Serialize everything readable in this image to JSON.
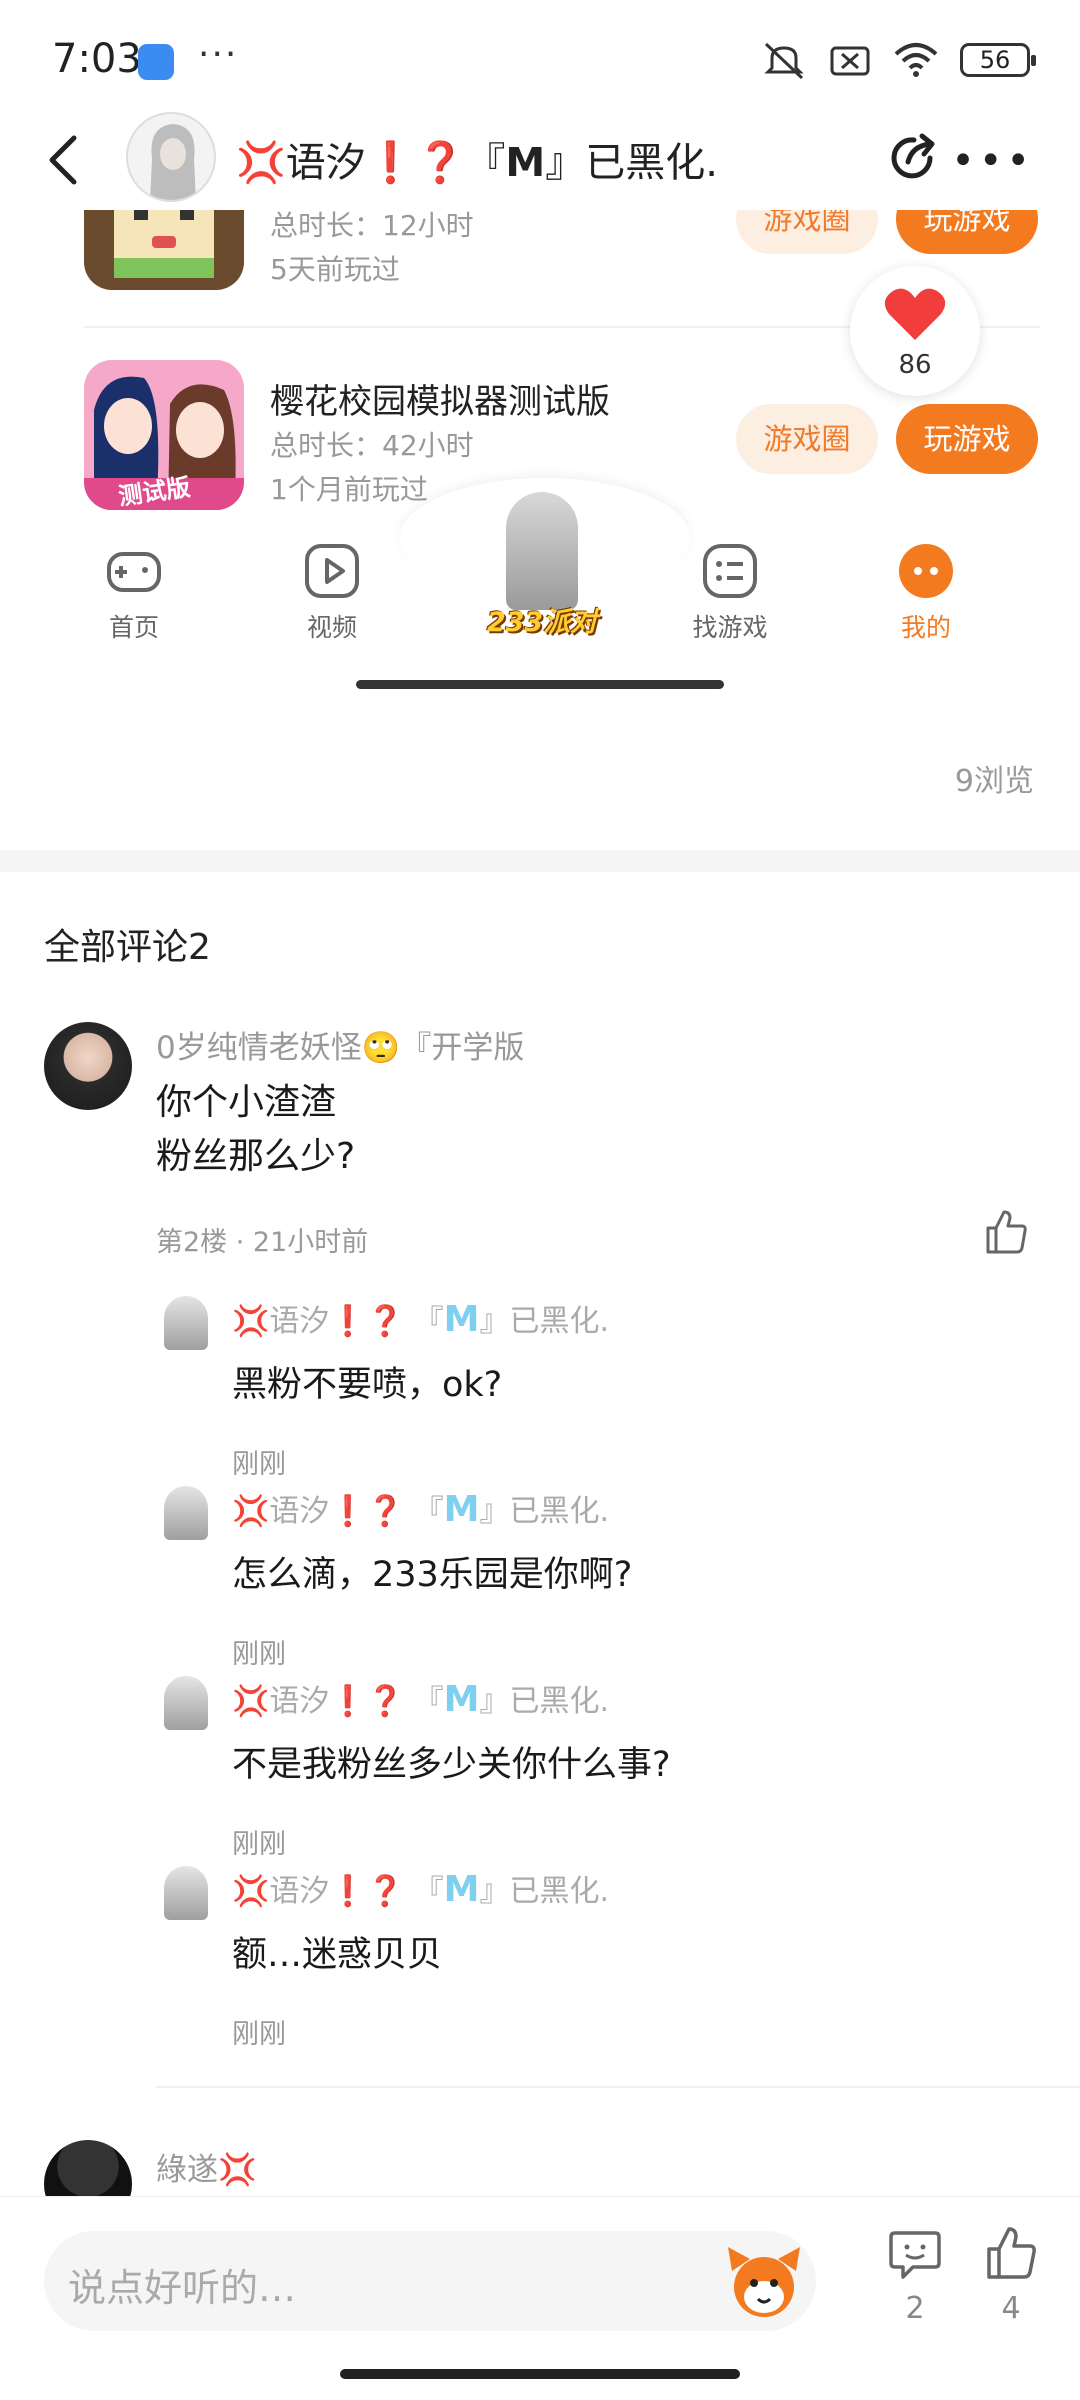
{
  "status_bar": {
    "time": "7:03",
    "more": "···",
    "battery": "56"
  },
  "header": {
    "title": "💢语汐❗❓『𝗠』已黑化."
  },
  "embedded": {
    "games": [
      {
        "name": "",
        "sub1": "总时长：12小时",
        "sub2": "5天前玩过",
        "circle_label": "游戏圈",
        "play_label": "玩游戏"
      },
      {
        "name": "樱花校园模拟器测试版",
        "sub1": "总时长：42小时",
        "sub2": "1个月前玩过",
        "circle_label": "游戏圈",
        "play_label": "玩游戏",
        "icon_badge": "测试版"
      }
    ],
    "like_count": "86",
    "tabs": [
      {
        "label": "首页"
      },
      {
        "label": "视频"
      },
      {
        "label": "233派对"
      },
      {
        "label": "找游戏"
      },
      {
        "label": "我的"
      }
    ]
  },
  "views": "9浏览",
  "comments": {
    "title": "全部评论2",
    "main": {
      "author": "0岁纯情老妖怪🙄『开学版",
      "text": "你个小渣渣\n粉丝那么少?",
      "meta": "第2楼 · 21小时前"
    },
    "reply_author": {
      "prefix": "💢语汐",
      "marks": "❗❓",
      "bracket_open": "『",
      "m": "M",
      "bracket_close": "』已黑化."
    },
    "replies": [
      {
        "text": "黑粉不要喷，ok?",
        "time": "刚刚"
      },
      {
        "text": "怎么滴，233乐园是你啊?",
        "time": "刚刚"
      },
      {
        "text": "不是我粉丝多少关你什么事?",
        "time": "刚刚"
      },
      {
        "text": "额…迷惑贝贝",
        "time": "刚刚"
      }
    ],
    "next_author": "綠遂💢"
  },
  "bottom_bar": {
    "placeholder": "说点好听的…",
    "comment_count": "2",
    "like_count": "4"
  },
  "colors": {
    "accent": "#f47a20",
    "accent_light": "#fdeee2"
  }
}
